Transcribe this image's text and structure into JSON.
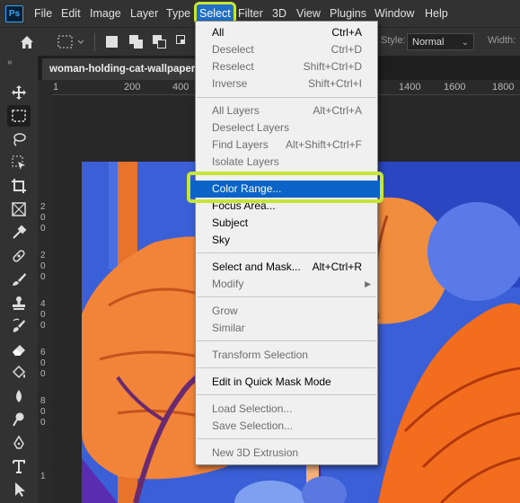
{
  "app": {
    "logo": "Ps"
  },
  "menubar": {
    "items": [
      "File",
      "Edit",
      "Image",
      "Layer",
      "Type",
      "Select",
      "Filter",
      "3D",
      "View",
      "Plugins",
      "Window",
      "Help"
    ],
    "active": "Select"
  },
  "options": {
    "style_label": "Style:",
    "style_value": "Normal",
    "width_label": "Width:"
  },
  "document": {
    "tab_title": "woman-holding-cat-wallpaper.j"
  },
  "ruler": {
    "h_ticks": [
      "1",
      "200",
      "400",
      "1400",
      "1600",
      "1800"
    ],
    "v_ticks": [
      "2",
      "0",
      "0",
      "2",
      "0",
      "0",
      "4",
      "0",
      "0",
      "6",
      "0",
      "0",
      "8",
      "0",
      "0",
      "1"
    ]
  },
  "select_menu": {
    "items": [
      {
        "label": "All",
        "shortcut": "Ctrl+A",
        "enabled": true
      },
      {
        "label": "Deselect",
        "shortcut": "Ctrl+D",
        "enabled": false
      },
      {
        "label": "Reselect",
        "shortcut": "Shift+Ctrl+D",
        "enabled": false
      },
      {
        "label": "Inverse",
        "shortcut": "Shift+Ctrl+I",
        "enabled": false
      },
      {
        "label": "All Layers",
        "shortcut": "Alt+Ctrl+A",
        "enabled": false
      },
      {
        "label": "Deselect Layers",
        "shortcut": "",
        "enabled": false
      },
      {
        "label": "Find Layers",
        "shortcut": "Alt+Shift+Ctrl+F",
        "enabled": false
      },
      {
        "label": "Isolate Layers",
        "shortcut": "",
        "enabled": false
      },
      {
        "label": "Color Range...",
        "shortcut": "",
        "enabled": true,
        "highlighted": true
      },
      {
        "label": "Focus Area...",
        "shortcut": "",
        "enabled": true
      },
      {
        "label": "Subject",
        "shortcut": "",
        "enabled": true
      },
      {
        "label": "Sky",
        "shortcut": "",
        "enabled": true
      },
      {
        "label": "Select and Mask...",
        "shortcut": "Alt+Ctrl+R",
        "enabled": true
      },
      {
        "label": "Modify",
        "shortcut": "",
        "enabled": false,
        "submenu": true
      },
      {
        "label": "Grow",
        "shortcut": "",
        "enabled": false
      },
      {
        "label": "Similar",
        "shortcut": "",
        "enabled": false
      },
      {
        "label": "Transform Selection",
        "shortcut": "",
        "enabled": false
      },
      {
        "label": "Edit in Quick Mask Mode",
        "shortcut": "",
        "enabled": true
      },
      {
        "label": "Load Selection...",
        "shortcut": "",
        "enabled": false
      },
      {
        "label": "Save Selection...",
        "shortcut": "",
        "enabled": false
      },
      {
        "label": "New 3D Extrusion",
        "shortcut": "",
        "enabled": false
      }
    ]
  },
  "colors": {
    "highlight": "#0a64c8",
    "annotation": "#c5e537",
    "chrome": "#323232"
  },
  "tools": [
    "move-icon",
    "marquee-icon",
    "lasso-icon",
    "object-select-icon",
    "crop-icon",
    "frame-icon",
    "eyedropper-icon",
    "healing-icon",
    "brush-icon",
    "stamp-icon",
    "history-brush-icon",
    "eraser-icon",
    "bucket-icon",
    "blur-icon",
    "dodge-icon",
    "pen-icon",
    "type-icon",
    "path-select-icon"
  ]
}
